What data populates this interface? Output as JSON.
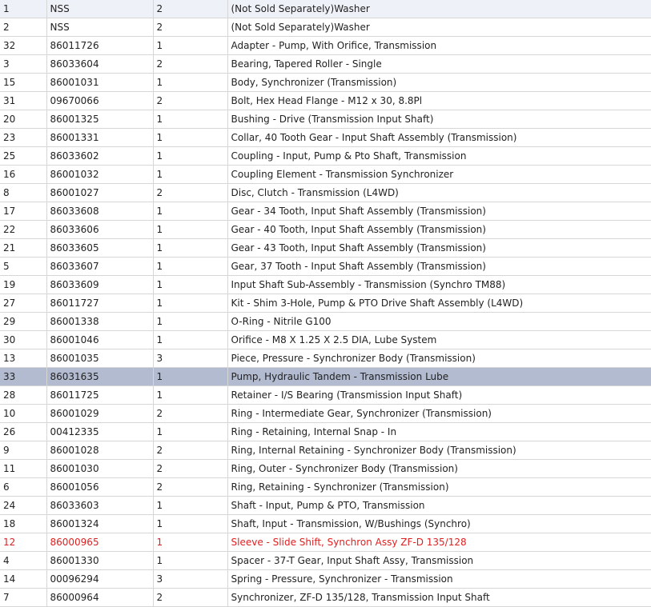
{
  "parts_table": {
    "rows": [
      {
        "ref": "1",
        "part_no": "NSS",
        "qty": "2",
        "description": "(Not Sold Separately)Washer"
      },
      {
        "ref": "2",
        "part_no": "NSS",
        "qty": "2",
        "description": "(Not Sold Separately)Washer"
      },
      {
        "ref": "32",
        "part_no": "86011726",
        "qty": "1",
        "description": "Adapter - Pump, With Orifice, Transmission"
      },
      {
        "ref": "3",
        "part_no": "86033604",
        "qty": "2",
        "description": "Bearing, Tapered Roller - Single"
      },
      {
        "ref": "15",
        "part_no": "86001031",
        "qty": "1",
        "description": "Body, Synchronizer (Transmission)"
      },
      {
        "ref": "31",
        "part_no": "09670066",
        "qty": "2",
        "description": "Bolt, Hex Head Flange - M12 x 30, 8.8Pl"
      },
      {
        "ref": "20",
        "part_no": "86001325",
        "qty": "1",
        "description": "Bushing - Drive (Transmission Input Shaft)"
      },
      {
        "ref": "23",
        "part_no": "86001331",
        "qty": "1",
        "description": "Collar, 40 Tooth Gear - Input Shaft Assembly (Transmission)"
      },
      {
        "ref": "25",
        "part_no": "86033602",
        "qty": "1",
        "description": "Coupling - Input, Pump & Pto Shaft, Transmission"
      },
      {
        "ref": "16",
        "part_no": "86001032",
        "qty": "1",
        "description": "Coupling Element - Transmission Synchronizer"
      },
      {
        "ref": "8",
        "part_no": "86001027",
        "qty": "2",
        "description": "Disc, Clutch - Transmission (L4WD)"
      },
      {
        "ref": "17",
        "part_no": "86033608",
        "qty": "1",
        "description": "Gear - 34 Tooth, Input Shaft Assembly (Transmission)"
      },
      {
        "ref": "22",
        "part_no": "86033606",
        "qty": "1",
        "description": "Gear - 40 Tooth, Input Shaft Assembly (Transmission)"
      },
      {
        "ref": "21",
        "part_no": "86033605",
        "qty": "1",
        "description": "Gear - 43 Tooth, Input Shaft Assembly (Transmission)"
      },
      {
        "ref": "5",
        "part_no": "86033607",
        "qty": "1",
        "description": "Gear, 37 Tooth - Input Shaft Assembly (Transmission)"
      },
      {
        "ref": "19",
        "part_no": "86033609",
        "qty": "1",
        "description": "Input Shaft Sub-Assembly - Transmission (Synchro TM88)"
      },
      {
        "ref": "27",
        "part_no": "86011727",
        "qty": "1",
        "description": "Kit - Shim 3-Hole, Pump & PTO Drive Shaft Assembly (L4WD)"
      },
      {
        "ref": "29",
        "part_no": "86001338",
        "qty": "1",
        "description": "O-Ring - Nitrile G100"
      },
      {
        "ref": "30",
        "part_no": "86001046",
        "qty": "1",
        "description": "Orifice - M8 X 1.25 X 2.5 DIA, Lube System"
      },
      {
        "ref": "13",
        "part_no": "86001035",
        "qty": "3",
        "description": "Piece, Pressure - Synchronizer Body (Transmission)"
      },
      {
        "ref": "33",
        "part_no": "86031635",
        "qty": "1",
        "description": "Pump, Hydraulic Tandem - Transmission Lube"
      },
      {
        "ref": "28",
        "part_no": "86011725",
        "qty": "1",
        "description": "Retainer - I/S Bearing (Transmission Input Shaft)"
      },
      {
        "ref": "10",
        "part_no": "86001029",
        "qty": "2",
        "description": "Ring - Intermediate Gear, Synchronizer (Transmission)"
      },
      {
        "ref": "26",
        "part_no": "00412335",
        "qty": "1",
        "description": "Ring - Retaining, Internal Snap - In"
      },
      {
        "ref": "9",
        "part_no": "86001028",
        "qty": "2",
        "description": "Ring, Internal Retaining - Synchronizer Body (Transmission)"
      },
      {
        "ref": "11",
        "part_no": "86001030",
        "qty": "2",
        "description": "Ring, Outer - Synchronizer Body (Transmission)"
      },
      {
        "ref": "6",
        "part_no": "86001056",
        "qty": "2",
        "description": "Ring, Retaining - Synchronizer (Transmission)"
      },
      {
        "ref": "24",
        "part_no": "86033603",
        "qty": "1",
        "description": "Shaft - Input, Pump & PTO, Transmission"
      },
      {
        "ref": "18",
        "part_no": "86001324",
        "qty": "1",
        "description": "Shaft, Input - Transmission, W/Bushings (Synchro)"
      },
      {
        "ref": "12",
        "part_no": "86000965",
        "qty": "1",
        "description": "Sleeve - Slide Shift, Synchron Assy ZF-D 135/128"
      },
      {
        "ref": "4",
        "part_no": "86001330",
        "qty": "1",
        "description": "Spacer - 37-T Gear, Input Shaft Assy, Transmission"
      },
      {
        "ref": "14",
        "part_no": "00096294",
        "qty": "3",
        "description": "Spring - Pressure, Synchronizer - Transmission"
      },
      {
        "ref": "7",
        "part_no": "86000964",
        "qty": "2",
        "description": "Synchronizer, ZF-D 135/128, Transmission Input Shaft"
      }
    ],
    "selected_row": 20,
    "highlighted_row": 29
  },
  "colors": {
    "selected_background": "#b3bbd0",
    "highlight_text": "#e02020",
    "grid_line": "#d6d6d6"
  }
}
